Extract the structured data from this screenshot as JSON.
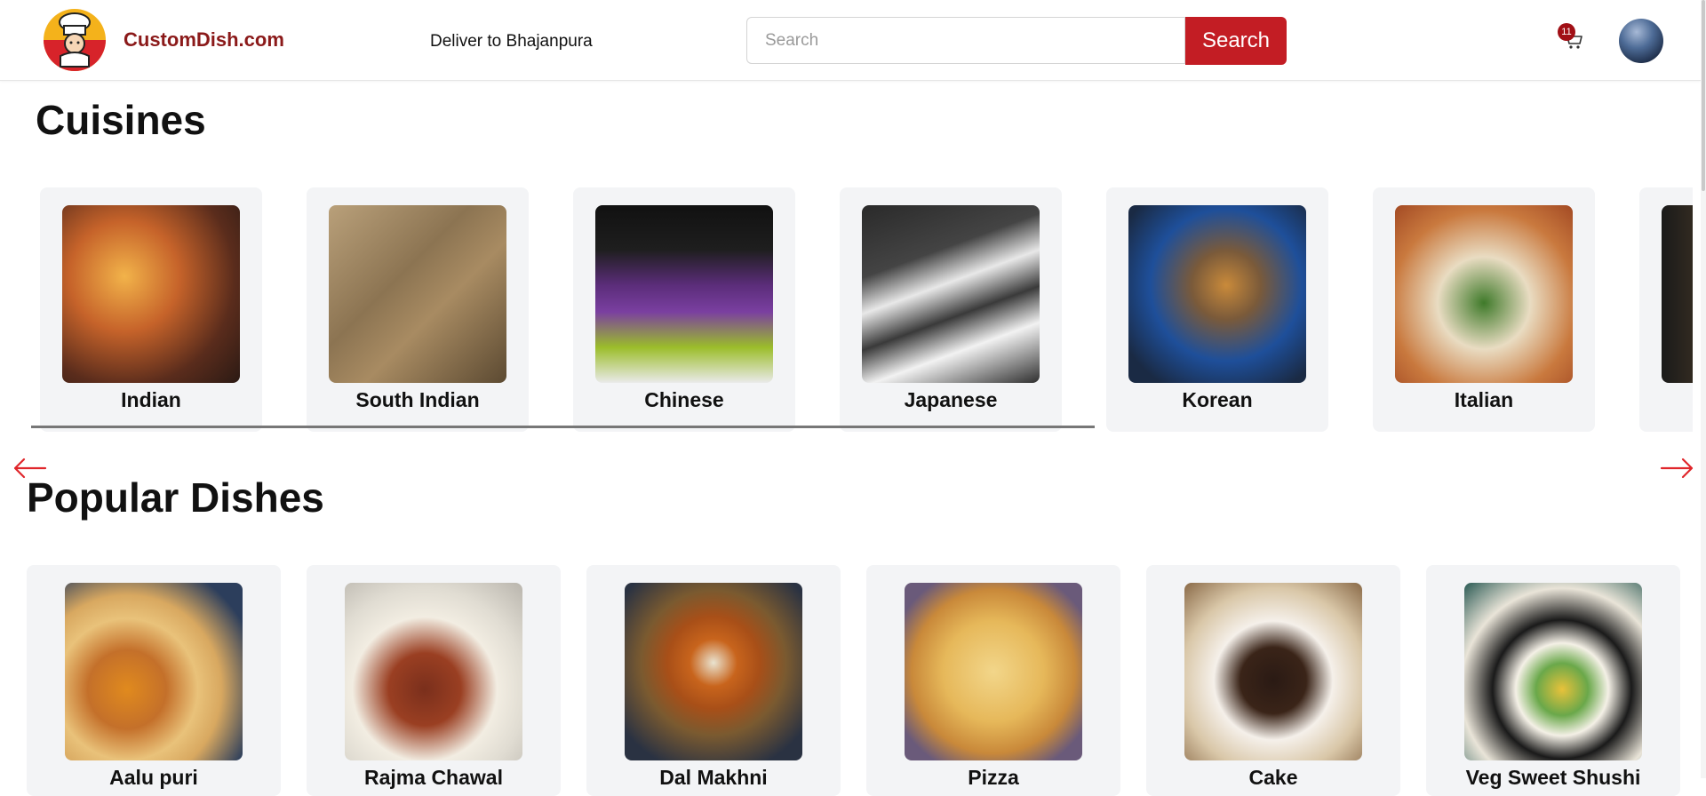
{
  "header": {
    "brand": "CustomDish.com",
    "deliver_text": "Deliver to Bhajanpura",
    "search_placeholder": "Search",
    "search_button": "Search",
    "cart_count": "11"
  },
  "cuisines": {
    "title": "Cuisines",
    "items": [
      {
        "label": "Indian"
      },
      {
        "label": "South Indian"
      },
      {
        "label": "Chinese"
      },
      {
        "label": "Japanese"
      },
      {
        "label": "Korean"
      },
      {
        "label": "Italian"
      }
    ]
  },
  "popular": {
    "title": "Popular Dishes",
    "items": [
      {
        "label": "Aalu puri"
      },
      {
        "label": "Rajma Chawal"
      },
      {
        "label": "Dal Makhni"
      },
      {
        "label": "Pizza"
      },
      {
        "label": "Cake"
      },
      {
        "label": "Veg Sweet Shushi"
      }
    ]
  },
  "colors": {
    "accent": "#c31d24",
    "brand": "#8b1a1a",
    "card_bg": "#f3f4f6"
  },
  "icons": {
    "logo": "chef-logo-icon",
    "cart": "cart-icon",
    "prev": "arrow-left-icon",
    "next": "arrow-right-icon"
  }
}
